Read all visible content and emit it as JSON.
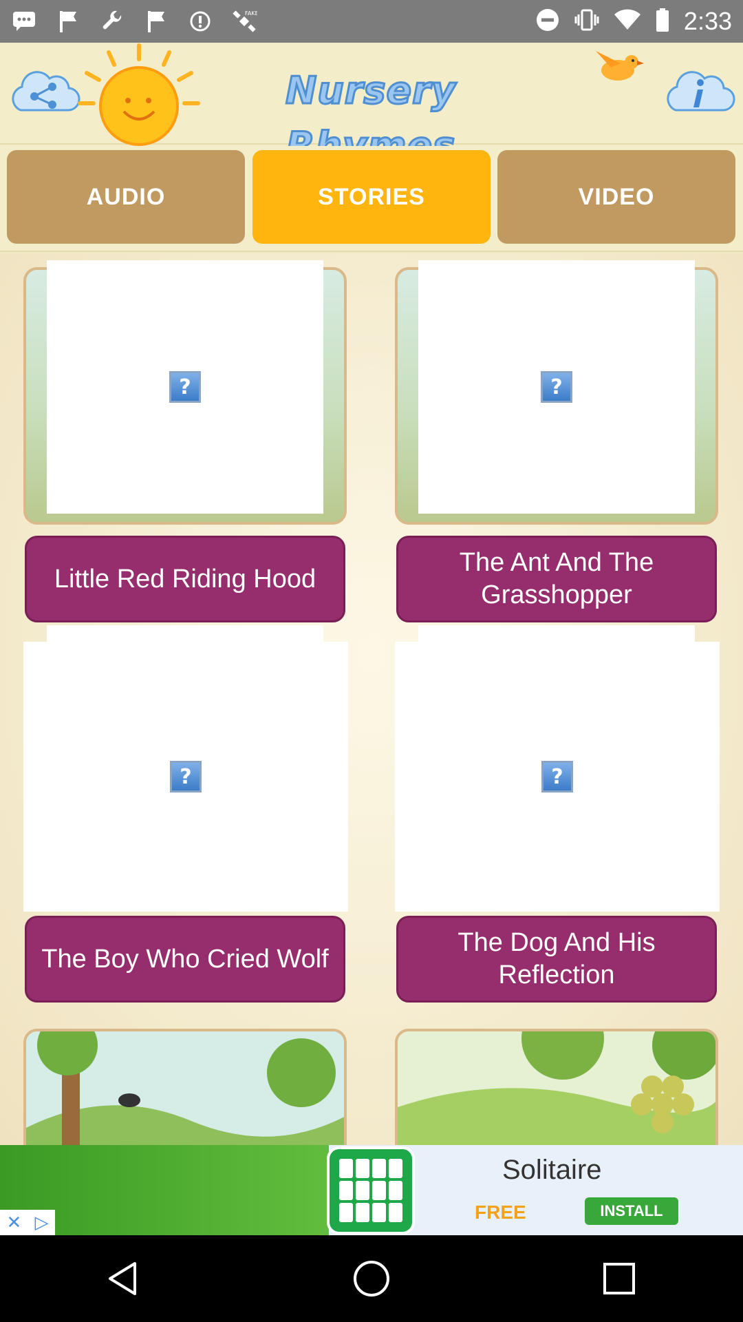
{
  "status_bar": {
    "time": "2:33",
    "icons": [
      "messages-icon",
      "flag-icon",
      "wrench-icon",
      "flag-icon",
      "fake-gps-icon",
      "satellite-icon",
      "do-not-disturb-icon",
      "vibrate-icon",
      "wifi-icon",
      "battery-icon"
    ]
  },
  "header": {
    "title": "Nursery Rhymes",
    "share_icon": "share-icon",
    "info_icon": "info-icon"
  },
  "tabs": [
    {
      "label": "AUDIO",
      "active": false
    },
    {
      "label": "STORIES",
      "active": true
    },
    {
      "label": "VIDEO",
      "active": false
    }
  ],
  "stories": [
    {
      "title": "Little Red Riding Hood"
    },
    {
      "title": "The Ant And The Grasshopper"
    },
    {
      "title": "The Boy Who Cried Wolf"
    },
    {
      "title": "The Dog And His Reflection"
    }
  ],
  "ad": {
    "title": "Solitaire",
    "free_label": "FREE",
    "install_label": "INSTALL"
  },
  "colors": {
    "tab_inactive": "#c19a62",
    "tab_active": "#ffb40e",
    "story_label": "#962e6d",
    "background": "#f1ecc6"
  }
}
